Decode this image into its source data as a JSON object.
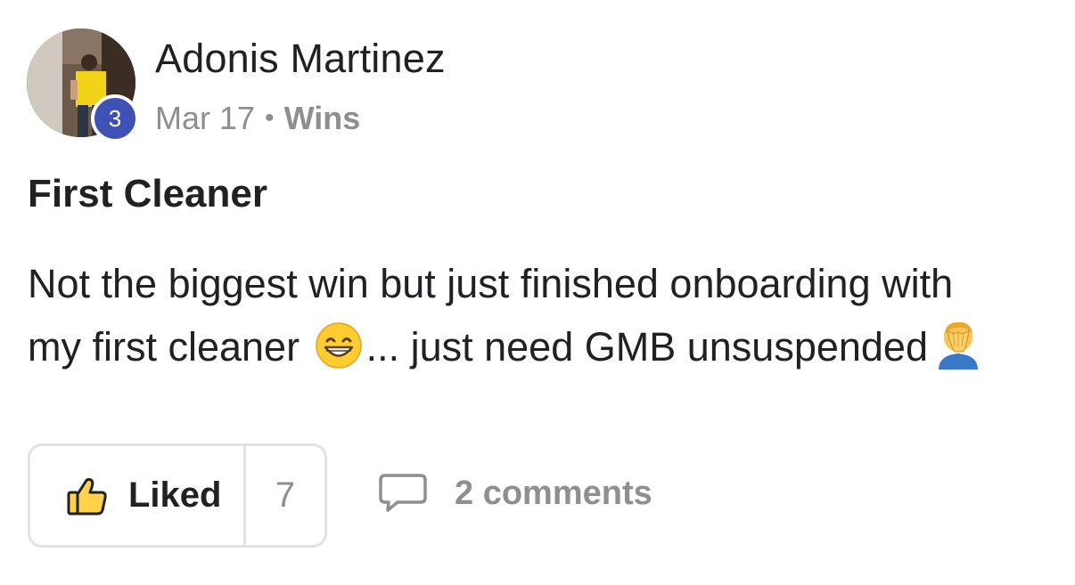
{
  "post": {
    "author": {
      "name": "Adonis Martinez",
      "level": "3"
    },
    "date": "Mar 17",
    "separator": "•",
    "category": "Wins",
    "title": "First Cleaner",
    "body": {
      "line1": "Not the biggest win but just finished onboarding with",
      "line2_before": "my first cleaner",
      "line2_middle": "... just need GMB unsuspended",
      "emoji1": "grinning-face-with-smiling-eyes",
      "emoji2": "man-facepalming"
    },
    "actions": {
      "like_label": "Liked",
      "like_count": "7",
      "comments_label": "2 comments",
      "like_icon": "thumbs-up-icon",
      "comment_icon": "comment-bubble-icon"
    }
  },
  "colors": {
    "text": "#202124",
    "muted": "#8e8e93",
    "badge": "#3f51b5",
    "thumb_fill": "#ffd24a",
    "border": "#e3e3e6"
  }
}
